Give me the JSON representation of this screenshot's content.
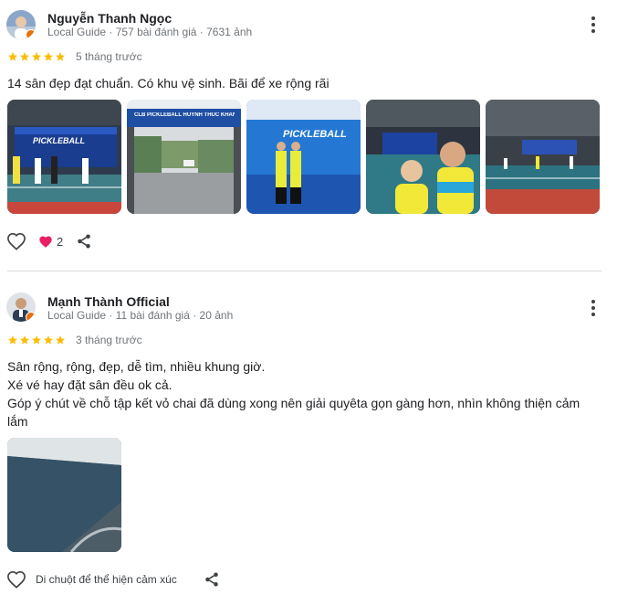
{
  "reviews": [
    {
      "author": "Nguyễn Thanh Ngọc",
      "meta": "Local Guide · 757 bài đánh giá · 7631 ảnh",
      "rating": 5,
      "time_ago": "5 tháng trước",
      "text_lines": [
        "14 sân đẹp đạt chuẩn. Có khu vệ sinh. Bãi để xe rộng rãi"
      ],
      "photos": [
        {
          "icon": "pickleball-court-banner-photo",
          "banner_text": "PICKLEBALL"
        },
        {
          "icon": "club-gate-photo",
          "banner_text": "CLB PICKLEBALL HUỲNH THÚC KHÁNG"
        },
        {
          "icon": "tournament-banner-photo",
          "banner_text": "PICKLEBALL"
        },
        {
          "icon": "selfie-photo",
          "banner_text": ""
        },
        {
          "icon": "indoor-court-photo",
          "banner_text": ""
        }
      ],
      "like_count": "2"
    },
    {
      "author": "Mạnh Thành Official",
      "meta": "Local Guide · 11 bài đánh giá · 20 ảnh",
      "rating": 5,
      "time_ago": "3 tháng trước",
      "text_lines": [
        "Sân rộng, rộng, đẹp, dễ tìm, nhiều khung giờ.",
        "Xé vé hay đặt sân đều ok cả.",
        "Góp ý chút về chỗ tập kết vỏ chai đã dùng xong nên giải quyêta gọn gàng hơn, nhìn không thiện cảm",
        "lắm"
      ],
      "photos": [
        {
          "icon": "court-floor-photo",
          "banner_text": ""
        }
      ],
      "react_hint": "Di chuột để thể hiện cảm xúc"
    }
  ],
  "colors": {
    "star": "#fbbc04",
    "heart_pink": "#e91e63",
    "badge": "#e8710a",
    "court_blue": "#1a3d8f"
  }
}
